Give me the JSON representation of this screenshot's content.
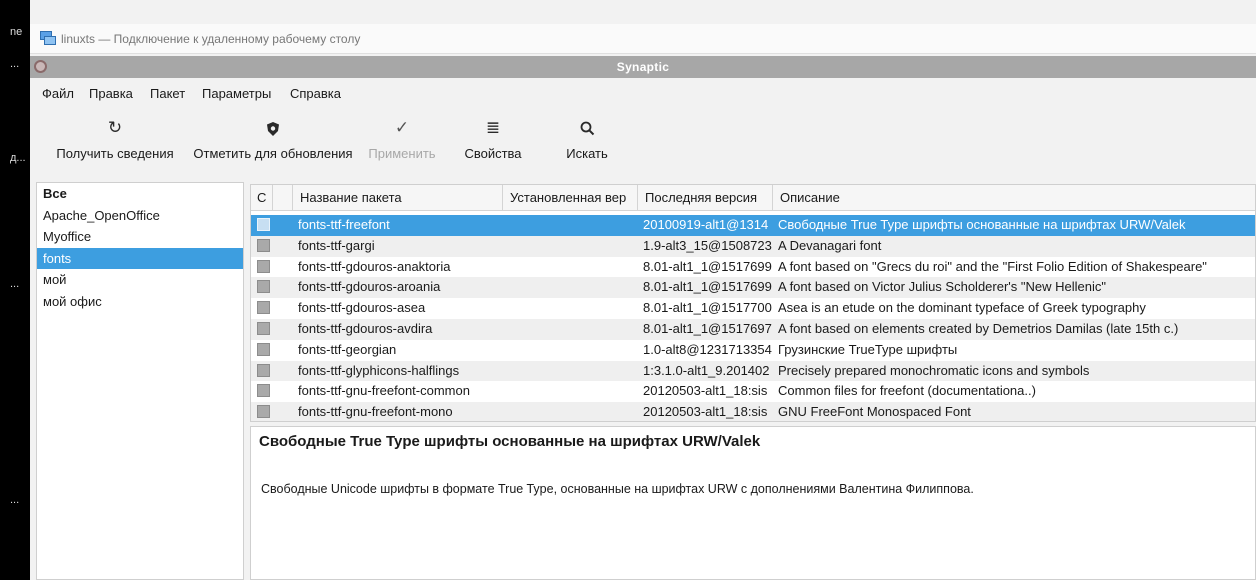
{
  "desktop": {
    "strip_labels": [
      "ne",
      "...",
      "д...",
      "...",
      "..."
    ]
  },
  "rdp": {
    "title": "linuxts — Подключение к удаленному рабочему столу"
  },
  "app": {
    "title": "Synaptic"
  },
  "menu": [
    "Файл",
    "Правка",
    "Пакет",
    "Параметры",
    "Справка"
  ],
  "toolbar": {
    "reload": {
      "label": "Получить сведения",
      "icon": "refresh-icon"
    },
    "mark_upgrades": {
      "label": "Отметить для обновления",
      "icon": "shield-icon"
    },
    "apply": {
      "label": "Применить",
      "icon": "checkmark-icon",
      "disabled": true
    },
    "properties": {
      "label": "Свойства",
      "icon": "list-icon"
    },
    "search": {
      "label": "Искать",
      "icon": "search-icon"
    }
  },
  "filters": {
    "items": [
      "Все",
      "Apache_OpenOffice",
      "Myoffice",
      "fonts",
      "мой",
      "мой офис"
    ],
    "selected": "fonts"
  },
  "table": {
    "columns": [
      "С",
      "Название пакета",
      "Установленная вер",
      "Последняя версия",
      "Описание"
    ],
    "rows": [
      {
        "name": "fonts-ttf-freefont",
        "installed": "",
        "latest": "20100919-alt1@1314",
        "desc": "Свободные True Type шрифты основанные на шрифтах URW/Valek"
      },
      {
        "name": "fonts-ttf-gargi",
        "installed": "",
        "latest": "1.9-alt3_15@1508723",
        "desc": "A Devanagari font"
      },
      {
        "name": "fonts-ttf-gdouros-anaktoria",
        "installed": "",
        "latest": "8.01-alt1_1@1517699",
        "desc": "A font based on \"Grecs du roi\" and the \"First Folio Edition of Shakespeare\""
      },
      {
        "name": "fonts-ttf-gdouros-aroania",
        "installed": "",
        "latest": "8.01-alt1_1@1517699",
        "desc": "A font based on Victor Julius Scholderer's \"New Hellenic\""
      },
      {
        "name": "fonts-ttf-gdouros-asea",
        "installed": "",
        "latest": "8.01-alt1_1@1517700",
        "desc": "Asea is an etude on the dominant typeface of Greek typography"
      },
      {
        "name": "fonts-ttf-gdouros-avdira",
        "installed": "",
        "latest": "8.01-alt1_1@1517697",
        "desc": "A font based on elements created by Demetrios Damilas (late 15th c.)"
      },
      {
        "name": "fonts-ttf-georgian",
        "installed": "",
        "latest": "1.0-alt8@1231713354",
        "desc": "Грузинские TrueType шрифты"
      },
      {
        "name": "fonts-ttf-glyphicons-halflings",
        "installed": "",
        "latest": "1:3.1.0-alt1_9.201402",
        "desc": "Precisely prepared monochromatic icons and symbols"
      },
      {
        "name": "fonts-ttf-gnu-freefont-common",
        "installed": "",
        "latest": "20120503-alt1_18:sis",
        "desc": "Common files for freefont (documentationa..)"
      },
      {
        "name": "fonts-ttf-gnu-freefont-mono",
        "installed": "",
        "latest": "20120503-alt1_18:sis",
        "desc": "GNU FreeFont Monospaced Font"
      }
    ],
    "selected_index": 0
  },
  "description": {
    "title": "Свободные True Type шрифты основанные на шрифтах URW/Valek",
    "body": "Свободные Unicode шрифты в формате True Type, основанные на шрифтах URW с дополнениями Валентина Филиппова."
  }
}
